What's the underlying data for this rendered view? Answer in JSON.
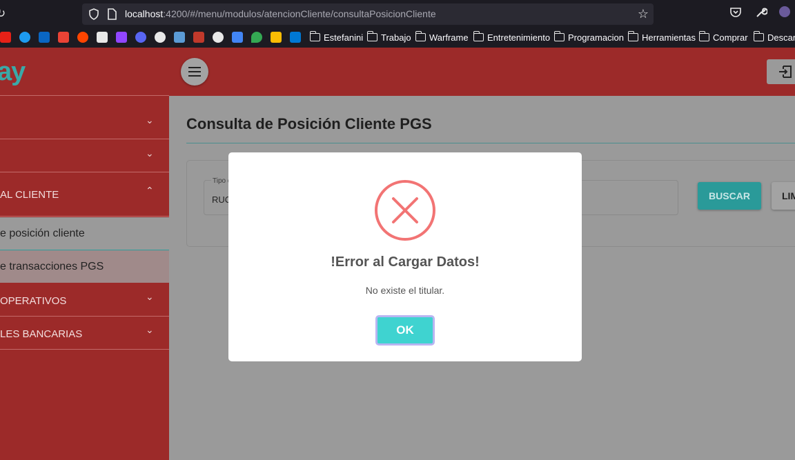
{
  "browser": {
    "url_host": "localhost",
    "url_path": ":4200/#/menu/modulos/atencionCliente/consultaPosicionCliente",
    "bookmarks": [
      "Estefanini",
      "Trabajo",
      "Warframe",
      "Entretenimiento",
      "Programacion",
      "Herramientas",
      "Comprar",
      "Descargas"
    ]
  },
  "sidebar": {
    "logo_text": "ay",
    "items": [
      {
        "label": ""
      },
      {
        "label": ""
      },
      {
        "label": "AL CLIENTE"
      },
      {
        "label": "OPERATIVOS"
      },
      {
        "label": "LES BANCARIAS"
      }
    ],
    "sub_items": [
      {
        "label": "e posición cliente"
      },
      {
        "label": "e transacciones PGS"
      }
    ]
  },
  "main": {
    "title": "Consulta de Posición Cliente PGS",
    "field_label": "Tipo d",
    "field_value": "RUC",
    "buscar_label": "BUSCAR",
    "limpiar_label": "LIMPIAR"
  },
  "modal": {
    "title": "!Error al Cargar Datos!",
    "message": "No existe el titular.",
    "ok_label": "OK"
  },
  "colors": {
    "brand_red": "#9c2a29",
    "accent_teal": "#2a9a99",
    "error_red": "#f27474",
    "ok_button": "#3fd3d0"
  }
}
